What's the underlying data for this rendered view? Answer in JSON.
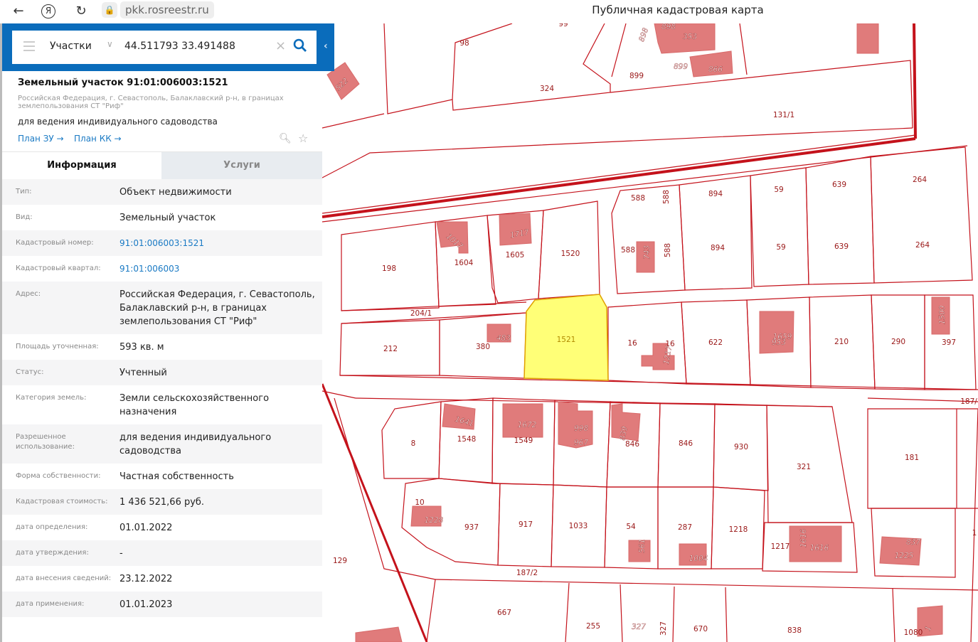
{
  "browser": {
    "url": "pkk.rosreestr.ru",
    "page_title": "Публичная кадастровая карта"
  },
  "search": {
    "layer": "Участки",
    "query": "44.511793 33.491488"
  },
  "object": {
    "title": "Земельный участок 91:01:006003:1521",
    "address": "Российская Федерация, г. Севастополь, Балаклавский р-н, в границах землепользования СТ \"Риф\"",
    "use": "для ведения индивидуального садоводства",
    "plan_zu": "План ЗУ →",
    "plan_kk": "План КК →"
  },
  "tabs": [
    {
      "label": "Информация",
      "active": true
    },
    {
      "label": "Услуги",
      "active": false
    }
  ],
  "rows": [
    {
      "label": "Тип:",
      "value": "Объект недвижимости"
    },
    {
      "label": "Вид:",
      "value": "Земельный участок"
    },
    {
      "label": "Кадастровый номер:",
      "value": "91:01:006003:1521",
      "link": true
    },
    {
      "label": "Кадастровый квартал:",
      "value": "91:01:006003",
      "link": true
    },
    {
      "label": "Адрес:",
      "value": "Российская Федерация, г. Севастополь, Балаклавский р-н, в границах землепользования СТ \"Риф\""
    },
    {
      "label": "Площадь уточненная:",
      "value": "593 кв. м"
    },
    {
      "label": "Статус:",
      "value": "Учтенный"
    },
    {
      "label": "Категория земель:",
      "value": "Земли сельскохозяйственного назначения"
    },
    {
      "label": "Разрешенное использование:",
      "value": "для ведения индивидуального садоводства"
    },
    {
      "label": "Форма собственности:",
      "value": "Частная собственность"
    },
    {
      "label": "Кадастровая стоимость:",
      "value": "1 436 521,66 руб."
    },
    {
      "label": "дата определения:",
      "value": "01.01.2022"
    },
    {
      "label": "дата утверждения:",
      "value": "-"
    },
    {
      "label": "дата внесения сведений:",
      "value": "23.12.2022"
    },
    {
      "label": "дата применения:",
      "value": "01.01.2023"
    }
  ],
  "colors": {
    "accent": "#0a6cbb",
    "boundary": "#c4121b",
    "building": "#e07b7b",
    "selected": "#ffff77"
  },
  "map": {
    "selected_parcel": "1521",
    "labels": [
      "98",
      "99",
      "898",
      "898",
      "353",
      "899",
      "899",
      "866",
      "324",
      "131/1",
      "522",
      "588",
      "588",
      "894",
      "59",
      "639",
      "264",
      "198",
      "1017",
      "1604",
      "1717",
      "1605",
      "1520",
      "588",
      "743",
      "588",
      "894",
      "59",
      "639",
      "264",
      "204/1",
      "212",
      "380",
      "483",
      "1521",
      "16",
      "16",
      "1217",
      "622",
      "1659",
      "953",
      "210",
      "290",
      "1500",
      "397",
      "187/",
      "8",
      "1641",
      "1548",
      "1672",
      "1549",
      "998",
      "967",
      "839",
      "846",
      "846",
      "930",
      "321",
      "181",
      "10",
      "1228",
      "937",
      "917",
      "1033",
      "54",
      "561",
      "287",
      "1004",
      "1218",
      "1217",
      "1616",
      "1616",
      "837",
      "1225",
      "129",
      "187/2",
      "667",
      "255",
      "327",
      "327",
      "670",
      "838",
      "1080",
      "1",
      "1"
    ]
  }
}
